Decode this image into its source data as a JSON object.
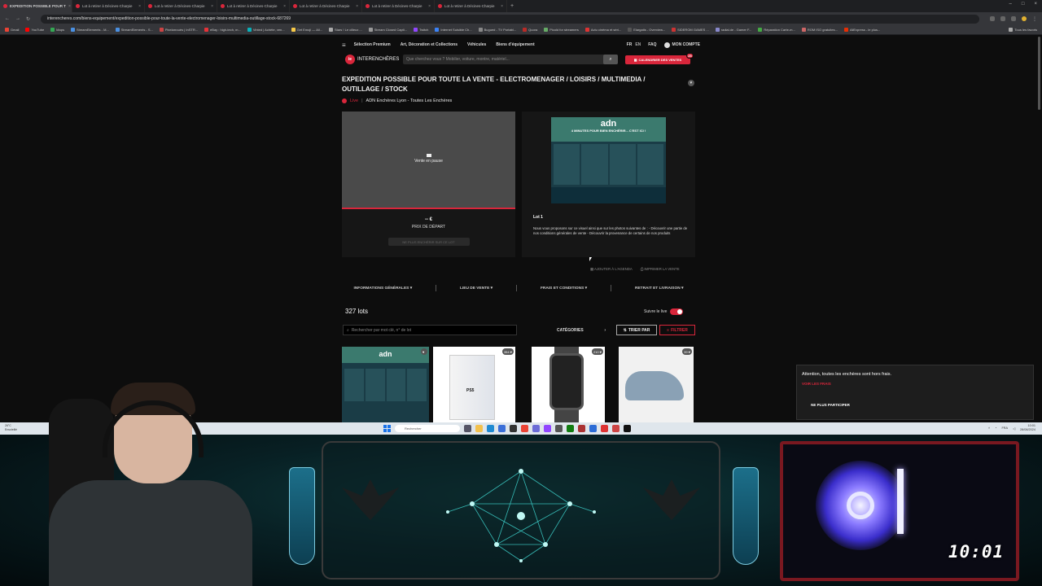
{
  "browser": {
    "tabs": [
      {
        "title": "EXPEDITION POSSIBLE POUR T",
        "active": true
      },
      {
        "title": "Lot à retirer à Décines-Charpie",
        "active": false
      },
      {
        "title": "Lot à retirer à Décines-Charpie",
        "active": false
      },
      {
        "title": "Lot à retirer à Décines-Charpie",
        "active": false
      },
      {
        "title": "Lot à retirer à Décines-Charpie",
        "active": false
      },
      {
        "title": "Lot à retirer à Décines-Charpie",
        "active": false
      },
      {
        "title": "Lot à retirer à Décines-Charpie",
        "active": false
      }
    ],
    "new_tab": "+",
    "url": "interencheres.com/biens-equipement/expedition-possible-pour-toute-la-vente-electromenager-loisirs-multimedia-outillage-stock-687269",
    "bookmarks": [
      "Gmail",
      "YouTube",
      "Maps",
      "StreamElements - M...",
      "StreamElements - S...",
      "Pixelarrouès | InSTR...",
      "eBay : high-tech, m...",
      "Vinted | Achète, ven...",
      "Get Emoji — All...",
      "Stars ! Le cilleux ...",
      "Stream Closed Capti...",
      "Twitch",
      "Internet Suisible Ch...",
      "Bugued - TV Portabl...",
      "Quora",
      "Picold for streamers",
      "Actu cinéma et séri...",
      "Elargatis - Overview...",
      "SIDEROM GAMES ...",
      "radial.de - Gamer F...",
      "Réparation Carte-m...",
      "ROM ISO gratuites...",
      "AliExpress - le plus...",
      "Tous les favoris"
    ],
    "bookmark_colors": [
      "#ea4335",
      "#ff0000",
      "#34a853",
      "#4a90e2",
      "#4a90e2",
      "#c44",
      "#e53238",
      "#09b1ba",
      "#f7c948",
      "#aaa",
      "#999",
      "#9146ff",
      "#3b82f6",
      "#888",
      "#b92b27",
      "#6a6",
      "#d33",
      "#555",
      "#c33",
      "#88c",
      "#4a4",
      "#c66",
      "#e62e04",
      "#aaa"
    ]
  },
  "nav": {
    "menu_icon": "hamburger-icon",
    "links": [
      "Sélection Premium",
      "Art, Décoration et Collections",
      "Véhicules",
      "Biens d'équipement"
    ],
    "lang_fr": "FR",
    "lang_en": "EN",
    "faq": "FAQ",
    "account": "MON COMPTE"
  },
  "header": {
    "logo_mark": "ie",
    "logo_text": "INTERENCHÈRES",
    "search_placeholder": "Que cherchez vous ? Mobilier, voiture, montre, matériel...",
    "agenda_label": "CALENDRIER DES VENTES",
    "agenda_count": "25"
  },
  "sale": {
    "title": "EXPEDITION POSSIBLE POUR TOUTE LA VENTE - ELECTROMENAGER / LOISIRS / MULTIMEDIA / OUTILLAGE / STOCK",
    "live": "Live",
    "separator": "|",
    "house": "ADN Enchères Lyon - Toutes Les Enchères",
    "player_status": "Vente en pause",
    "price": "-- €",
    "price_label": "PRIX DE DÉPART",
    "stop_bid": "NE PLUS ENCHÉRIR SUR CE LOT",
    "lot_image_brand": "adn",
    "lot_image_slogan": "4 MINUTES POUR BIEN ENCHÉRIR... C'EST ICI !",
    "lot_number": "Lot 1",
    "lot_description": "Nous vous proposons sur ce visuel ainsi que sur les photos suivantes de : - Découvrir une partie de nos conditions générales de vente - Découvrir la provenance de certains de nos produits",
    "add_agenda": "AJOUTER À L'AGENDA",
    "print_sale": "IMPRIMER LA VENTE"
  },
  "info_tabs": [
    "INFORMATIONS GÉNÉRALES",
    "LIEU DE VENTE",
    "FRAIS ET CONDITIONS",
    "RETRAIT ET LIVRAISON"
  ],
  "lots": {
    "count": "327 lots",
    "follow_live": "Suivre le live",
    "search_placeholder": "Rechercher par mot clé, n° de lot",
    "categories": "CATÉGORIES",
    "sort": "TRIER PAR",
    "filter": "FILTRER",
    "cards": [
      {
        "badge": ""
      },
      {
        "badge": "354"
      },
      {
        "badge": "210"
      },
      {
        "badge": "39"
      }
    ],
    "card1_brand": "adn",
    "card2_label": "PS5"
  },
  "toast": {
    "message": "Attention, toutes les enchères sont hors frais.",
    "link": "VOIR LES FRAIS",
    "button": "NE PLUS PARTICIPER"
  },
  "taskbar": {
    "weather_temp": "26°C",
    "weather_text": "Ensoleillé",
    "search": "Rechercher",
    "lang": "FRA",
    "time": "10:01",
    "date": "28/08/2024"
  },
  "stream": {
    "clock": "10:01"
  },
  "colors": {
    "accent": "#d9263b",
    "page_bg": "#0d0d0d",
    "panel_bg": "#161616"
  }
}
